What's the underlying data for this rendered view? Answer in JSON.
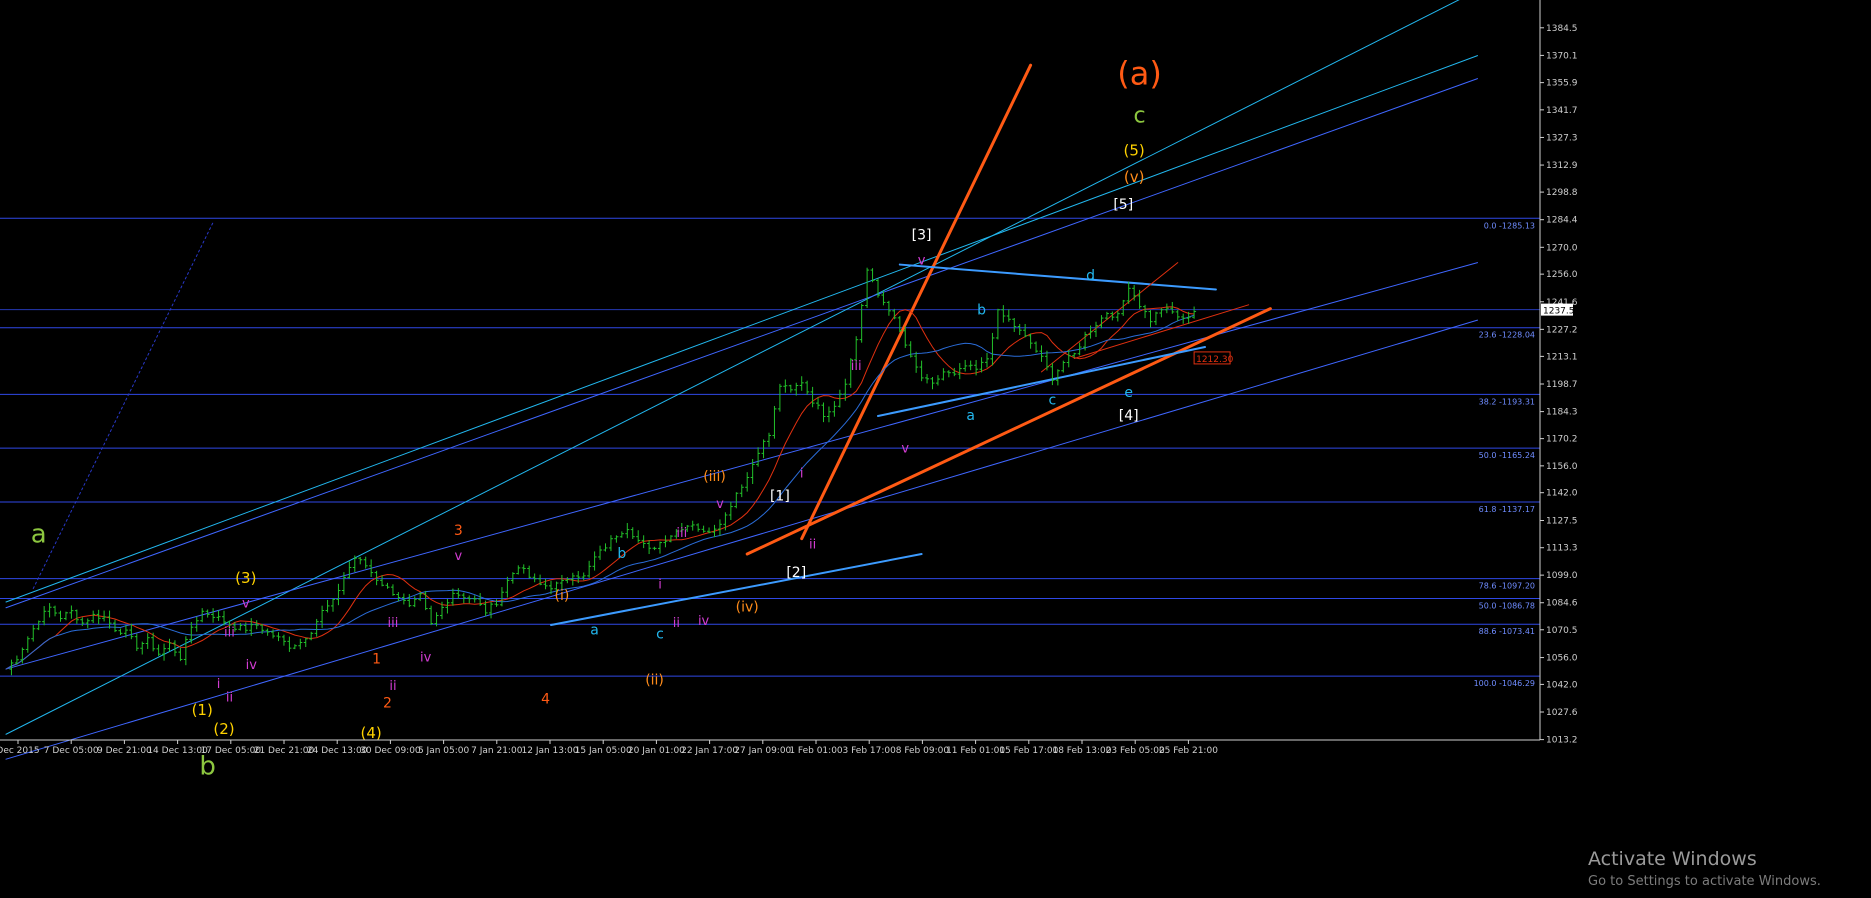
{
  "chart_data": {
    "type": "candlestick",
    "y_axis": {
      "ylim": [
        1013.0,
        1399.0
      ],
      "tick_labels": [
        {
          "value": 1384.5,
          "label": "1384.5"
        },
        {
          "value": 1370.1,
          "label": "1370.1"
        },
        {
          "value": 1355.9,
          "label": "1355.9"
        },
        {
          "value": 1341.7,
          "label": "1341.7"
        },
        {
          "value": 1327.3,
          "label": "1327.3"
        },
        {
          "value": 1312.9,
          "label": "1312.9"
        },
        {
          "value": 1298.8,
          "label": "1298.8"
        },
        {
          "value": 1284.4,
          "label": "1284.4"
        },
        {
          "value": 1270.0,
          "label": "1270.0"
        },
        {
          "value": 1256.0,
          "label": "1256.0"
        },
        {
          "value": 1241.6,
          "label": "1241.6"
        },
        {
          "value": 1227.2,
          "label": "1227.2"
        },
        {
          "value": 1213.1,
          "label": "1213.1"
        },
        {
          "value": 1198.7,
          "label": "1198.7"
        },
        {
          "value": 1184.3,
          "label": "1184.3"
        },
        {
          "value": 1170.2,
          "label": "1170.2"
        },
        {
          "value": 1156.0,
          "label": "1156.0"
        },
        {
          "value": 1142.0,
          "label": "1142.0"
        },
        {
          "value": 1127.5,
          "label": "1127.5"
        },
        {
          "value": 1113.3,
          "label": "1113.3"
        },
        {
          "value": 1099.0,
          "label": "1099.0"
        },
        {
          "value": 1084.6,
          "label": "1084.6"
        },
        {
          "value": 1070.5,
          "label": "1070.5"
        },
        {
          "value": 1056.0,
          "label": "1056.0"
        },
        {
          "value": 1042.0,
          "label": "1042.0"
        },
        {
          "value": 1027.6,
          "label": "1027.6"
        },
        {
          "value": 1013.2,
          "label": "1013.2"
        }
      ],
      "current_price_label": "1237.5"
    },
    "x_axis": {
      "labels": [
        "Dec 2015",
        "7 Dec 05:00",
        "9 Dec 21:00",
        "14 Dec 13:00",
        "17 Dec 05:00",
        "21 Dec 21:00",
        "24 Dec 13:00",
        "30 Dec 09:00",
        "5 Jan 05:00",
        "7 Jan 21:00",
        "12 Jan 13:00",
        "15 Jan 05:00",
        "20 Jan 01:00",
        "22 Jan 17:00",
        "27 Jan 09:00",
        "1 Feb 01:00",
        "3 Feb 17:00",
        "8 Feb 09:00",
        "11 Feb 01:00",
        "15 Feb 17:00",
        "18 Feb 13:00",
        "23 Feb 05:00",
        "25 Feb 21:00"
      ]
    },
    "price_path": [
      [
        0,
        1050
      ],
      [
        2,
        1056
      ],
      [
        4,
        1066
      ],
      [
        6,
        1076
      ],
      [
        8,
        1082
      ],
      [
        10,
        1077
      ],
      [
        12,
        1080
      ],
      [
        14,
        1074
      ],
      [
        16,
        1078
      ],
      [
        18,
        1077
      ],
      [
        20,
        1071
      ],
      [
        22,
        1069
      ],
      [
        24,
        1062
      ],
      [
        26,
        1065
      ],
      [
        28,
        1058
      ],
      [
        30,
        1063
      ],
      [
        32,
        1056
      ],
      [
        34,
        1072
      ],
      [
        36,
        1080
      ],
      [
        38,
        1078
      ],
      [
        40,
        1075
      ],
      [
        42,
        1072
      ],
      [
        44,
        1071
      ],
      [
        46,
        1073
      ],
      [
        48,
        1069
      ],
      [
        50,
        1066
      ],
      [
        52,
        1062
      ],
      [
        54,
        1064
      ],
      [
        56,
        1070
      ],
      [
        58,
        1080
      ],
      [
        60,
        1085
      ],
      [
        62,
        1098
      ],
      [
        64,
        1108
      ],
      [
        66,
        1104
      ],
      [
        68,
        1097
      ],
      [
        70,
        1092
      ],
      [
        72,
        1088
      ],
      [
        74,
        1082
      ],
      [
        76,
        1088
      ],
      [
        78,
        1073
      ],
      [
        80,
        1082
      ],
      [
        82,
        1090
      ],
      [
        84,
        1088
      ],
      [
        86,
        1086
      ],
      [
        88,
        1080
      ],
      [
        90,
        1085
      ],
      [
        92,
        1096
      ],
      [
        94,
        1104
      ],
      [
        96,
        1098
      ],
      [
        98,
        1094
      ],
      [
        100,
        1093
      ],
      [
        102,
        1095
      ],
      [
        104,
        1100
      ],
      [
        106,
        1098
      ],
      [
        108,
        1108
      ],
      [
        110,
        1114
      ],
      [
        112,
        1120
      ],
      [
        114,
        1124
      ],
      [
        116,
        1117
      ],
      [
        118,
        1112
      ],
      [
        120,
        1116
      ],
      [
        122,
        1120
      ],
      [
        124,
        1124
      ],
      [
        126,
        1126
      ],
      [
        128,
        1121
      ],
      [
        130,
        1124
      ],
      [
        132,
        1130
      ],
      [
        134,
        1142
      ],
      [
        136,
        1150
      ],
      [
        138,
        1164
      ],
      [
        140,
        1172
      ],
      [
        142,
        1198
      ],
      [
        144,
        1195
      ],
      [
        146,
        1200
      ],
      [
        148,
        1190
      ],
      [
        150,
        1183
      ],
      [
        152,
        1188
      ],
      [
        154,
        1200
      ],
      [
        156,
        1222
      ],
      [
        158,
        1258
      ],
      [
        160,
        1245
      ],
      [
        162,
        1238
      ],
      [
        164,
        1226
      ],
      [
        166,
        1212
      ],
      [
        168,
        1202
      ],
      [
        170,
        1198
      ],
      [
        172,
        1205
      ],
      [
        174,
        1203
      ],
      [
        176,
        1208
      ],
      [
        178,
        1206
      ],
      [
        180,
        1212
      ],
      [
        182,
        1236
      ],
      [
        184,
        1232
      ],
      [
        186,
        1226
      ],
      [
        188,
        1220
      ],
      [
        190,
        1212
      ],
      [
        192,
        1202
      ],
      [
        194,
        1210
      ],
      [
        196,
        1214
      ],
      [
        198,
        1224
      ],
      [
        200,
        1230
      ],
      [
        202,
        1236
      ],
      [
        204,
        1234
      ],
      [
        206,
        1250
      ],
      [
        208,
        1240
      ],
      [
        210,
        1232
      ],
      [
        212,
        1238
      ],
      [
        214,
        1236
      ],
      [
        216,
        1232
      ],
      [
        218,
        1237
      ]
    ],
    "hlines": [
      {
        "value": 1285.13,
        "label": "0.0 -1285.13"
      },
      {
        "value": 1237.5,
        "label": ""
      },
      {
        "value": 1228.04,
        "label": "23.6 -1228.04"
      },
      {
        "value": 1193.31,
        "label": "38.2 -1193.31"
      },
      {
        "value": 1165.24,
        "label": "50.0 -1165.24"
      },
      {
        "value": 1137.17,
        "label": "61.8 -1137.17"
      },
      {
        "value": 1097.2,
        "label": "78.6 -1097.20"
      },
      {
        "value": 1086.78,
        "label": "50.0 -1086.78"
      },
      {
        "value": 1073.41,
        "label": "88.6 -1073.41"
      },
      {
        "value": 1046.29,
        "label": "100.0 -1046.29"
      }
    ],
    "price_tag": {
      "value": 1212.3,
      "label": "1212.30",
      "at": 218
    },
    "trendlines": [
      {
        "name": "cyan-channel-1",
        "color": "#22b7ee",
        "points": [
          [
            0,
            1016
          ],
          [
            270,
            1404
          ]
        ],
        "width": 1
      },
      {
        "name": "cyan-channel-2",
        "color": "#22b7ee",
        "points": [
          [
            0,
            1085
          ],
          [
            270,
            1370
          ]
        ],
        "width": 1
      },
      {
        "name": "blue-channel-upper",
        "color": "#3f66ff",
        "points": [
          [
            0,
            1082
          ],
          [
            270,
            1358
          ]
        ],
        "width": 1
      },
      {
        "name": "blue-channel-lower",
        "color": "#3f66ff",
        "points": [
          [
            0,
            1003
          ],
          [
            270,
            1232
          ]
        ],
        "width": 1
      },
      {
        "name": "blue-channel-middle",
        "color": "#3f66ff",
        "points": [
          [
            0,
            1050
          ],
          [
            270,
            1262
          ]
        ],
        "width": 1
      },
      {
        "name": "orange-steep",
        "color": "#ff5a14",
        "points": [
          [
            146,
            1118
          ],
          [
            188,
            1365
          ]
        ],
        "width": 3
      },
      {
        "name": "orange-base",
        "color": "#ff5a14",
        "points": [
          [
            136,
            1110
          ],
          [
            232,
            1238
          ]
        ],
        "width": 3
      },
      {
        "name": "blue-triangle-upper",
        "color": "#3c9bff",
        "points": [
          [
            164,
            1261
          ],
          [
            222,
            1248
          ]
        ],
        "width": 2
      },
      {
        "name": "blue-triangle-lower",
        "color": "#3c9bff",
        "points": [
          [
            160,
            1182
          ],
          [
            220,
            1218
          ]
        ],
        "width": 2
      },
      {
        "name": "blue-base-short",
        "color": "#3c9bff",
        "points": [
          [
            100,
            1073
          ],
          [
            168,
            1110
          ]
        ],
        "width": 2
      },
      {
        "name": "red-thin-1",
        "color": "#e03010",
        "points": [
          [
            190,
            1205
          ],
          [
            215,
            1262
          ]
        ],
        "width": 1
      },
      {
        "name": "red-thin-2",
        "color": "#e03010",
        "points": [
          [
            196,
            1212
          ],
          [
            228,
            1240
          ]
        ],
        "width": 1
      },
      {
        "name": "blue-dotted",
        "color": "#2838c8",
        "points": [
          [
            5,
            1092
          ],
          [
            38,
            1283
          ]
        ],
        "width": 1,
        "dashed": true
      }
    ],
    "wave_labels": [
      {
        "text": "(a)",
        "color": "#ff5a14",
        "size": 32,
        "at": [
          208,
          1355
        ]
      },
      {
        "text": "c",
        "color": "#8cc63f",
        "size": 22,
        "at": [
          208,
          1335
        ]
      },
      {
        "text": "(5)",
        "color": "#ffd200",
        "size": 15,
        "at": [
          207,
          1318
        ]
      },
      {
        "text": "(v)",
        "color": "#ff8c1a",
        "size": 15,
        "at": [
          207,
          1304
        ]
      },
      {
        "text": "[5]",
        "color": "#ffffff",
        "size": 14,
        "at": [
          205,
          1290
        ]
      },
      {
        "text": "[3]",
        "color": "#ffffff",
        "size": 14,
        "at": [
          168,
          1274
        ]
      },
      {
        "text": "v",
        "color": "#d23cd2",
        "size": 13,
        "at": [
          168,
          1261
        ]
      },
      {
        "text": "d",
        "color": "#22b7ee",
        "size": 14,
        "at": [
          199,
          1253
        ]
      },
      {
        "text": "b",
        "color": "#22b7ee",
        "size": 14,
        "at": [
          179,
          1235
        ]
      },
      {
        "text": "iii",
        "color": "#d23cd2",
        "size": 13,
        "at": [
          156,
          1206
        ]
      },
      {
        "text": "e",
        "color": "#22b7ee",
        "size": 14,
        "at": [
          206,
          1192
        ]
      },
      {
        "text": "[4]",
        "color": "#ffffff",
        "size": 14,
        "at": [
          206,
          1180
        ]
      },
      {
        "text": "a",
        "color": "#22b7ee",
        "size": 14,
        "at": [
          177,
          1180
        ]
      },
      {
        "text": "c",
        "color": "#22b7ee",
        "size": 14,
        "at": [
          192,
          1188
        ]
      },
      {
        "text": "v",
        "color": "#d23cd2",
        "size": 13,
        "at": [
          165,
          1163
        ]
      },
      {
        "text": "i",
        "color": "#d23cd2",
        "size": 13,
        "at": [
          146,
          1150
        ]
      },
      {
        "text": "[1]",
        "color": "#ffffff",
        "size": 14,
        "at": [
          142,
          1138
        ]
      },
      {
        "text": "ii",
        "color": "#d23cd2",
        "size": 13,
        "at": [
          148,
          1113
        ]
      },
      {
        "text": "[2]",
        "color": "#ffffff",
        "size": 14,
        "at": [
          145,
          1098
        ]
      },
      {
        "text": "(iii)",
        "color": "#ff8c1a",
        "size": 14,
        "at": [
          130,
          1148
        ]
      },
      {
        "text": "v",
        "color": "#d23cd2",
        "size": 13,
        "at": [
          131,
          1134
        ]
      },
      {
        "text": "iii",
        "color": "#d23cd2",
        "size": 13,
        "at": [
          124,
          1119
        ]
      },
      {
        "text": "(iv)",
        "color": "#ff8c1a",
        "size": 14,
        "at": [
          136,
          1080
        ]
      },
      {
        "text": "iv",
        "color": "#d23cd2",
        "size": 13,
        "at": [
          128,
          1073
        ]
      },
      {
        "text": "b",
        "color": "#22b7ee",
        "size": 14,
        "at": [
          113,
          1108
        ]
      },
      {
        "text": "i",
        "color": "#d23cd2",
        "size": 13,
        "at": [
          120,
          1092
        ]
      },
      {
        "text": "c",
        "color": "#22b7ee",
        "size": 14,
        "at": [
          120,
          1066
        ]
      },
      {
        "text": "ii",
        "color": "#d23cd2",
        "size": 13,
        "at": [
          123,
          1072
        ]
      },
      {
        "text": "(ii)",
        "color": "#ff8c1a",
        "size": 14,
        "at": [
          119,
          1042
        ]
      },
      {
        "text": "(i)",
        "color": "#ff8c1a",
        "size": 14,
        "at": [
          102,
          1086
        ]
      },
      {
        "text": "a",
        "color": "#22b7ee",
        "size": 14,
        "at": [
          108,
          1068
        ]
      },
      {
        "text": "4",
        "color": "#ff5a14",
        "size": 14,
        "at": [
          99,
          1032
        ]
      },
      {
        "text": "3",
        "color": "#ff5a14",
        "size": 14,
        "at": [
          83,
          1120
        ]
      },
      {
        "text": "v",
        "color": "#d23cd2",
        "size": 13,
        "at": [
          83,
          1107
        ]
      },
      {
        "text": "iii",
        "color": "#d23cd2",
        "size": 13,
        "at": [
          71,
          1072
        ]
      },
      {
        "text": "iv",
        "color": "#d23cd2",
        "size": 13,
        "at": [
          77,
          1054
        ]
      },
      {
        "text": "1",
        "color": "#ff5a14",
        "size": 14,
        "at": [
          68,
          1053
        ]
      },
      {
        "text": "ii",
        "color": "#d23cd2",
        "size": 13,
        "at": [
          71,
          1039
        ]
      },
      {
        "text": "2",
        "color": "#ff5a14",
        "size": 14,
        "at": [
          70,
          1030
        ]
      },
      {
        "text": "(4)",
        "color": "#ffd200",
        "size": 15,
        "at": [
          67,
          1014
        ]
      },
      {
        "text": "(3)",
        "color": "#ffd200",
        "size": 15,
        "at": [
          44,
          1095
        ]
      },
      {
        "text": "v",
        "color": "#d23cd2",
        "size": 13,
        "at": [
          44,
          1082
        ]
      },
      {
        "text": "iii",
        "color": "#d23cd2",
        "size": 13,
        "at": [
          41,
          1067
        ]
      },
      {
        "text": "iv",
        "color": "#d23cd2",
        "size": 13,
        "at": [
          45,
          1050
        ]
      },
      {
        "text": "i",
        "color": "#d23cd2",
        "size": 13,
        "at": [
          39,
          1040
        ]
      },
      {
        "text": "ii",
        "color": "#d23cd2",
        "size": 13,
        "at": [
          41,
          1033
        ]
      },
      {
        "text": "(1)",
        "color": "#ffd200",
        "size": 15,
        "at": [
          36,
          1026
        ]
      },
      {
        "text": "(2)",
        "color": "#ffd200",
        "size": 15,
        "at": [
          40,
          1016
        ]
      },
      {
        "text": "a",
        "color": "#8cc63f",
        "size": 26,
        "at": [
          6,
          1116
        ]
      },
      {
        "text": "b",
        "color": "#8cc63f",
        "size": 26,
        "at": [
          37,
          995
        ]
      }
    ]
  },
  "watermark": {
    "line1": "Activate Windows",
    "line2": "Go to Settings to activate Windows."
  },
  "colors": {
    "background": "#000000",
    "candle": "#22c12a",
    "ma_red": "#e03010",
    "ma_blue": "#2a6cd8",
    "grid_blue": "#3450ff",
    "axis_text": "#cfcfcf"
  }
}
